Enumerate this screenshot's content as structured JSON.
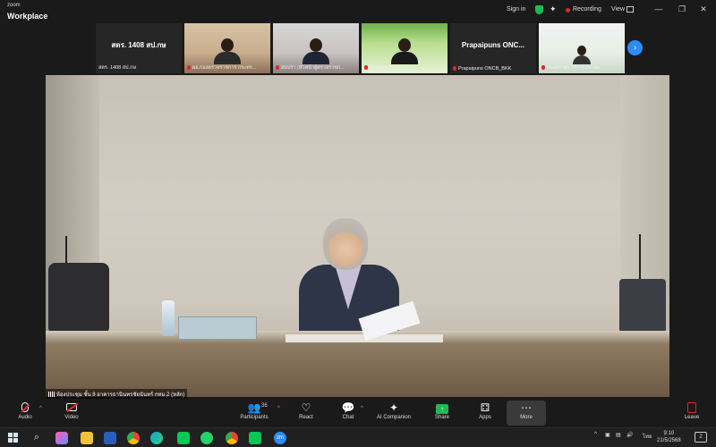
{
  "app": {
    "brand_small": "zoom",
    "brand_big": "Workplace"
  },
  "topbar": {
    "signin_label": "Sign in",
    "recording_label": "Recording",
    "view_label": "View"
  },
  "participants_strip": [
    {
      "display_name": "สตร. 1408 สป.กษ",
      "caption": "สตร. 1408 สป.กษ",
      "muted": false,
      "video": false
    },
    {
      "caption": "ผอ.กองตรวจราชการ กระทร...",
      "muted": true,
      "video": true
    },
    {
      "caption": "สมปรา (หัวหน้าผู้ตรวจราชก...",
      "muted": true,
      "video": true
    },
    {
      "caption": "สาวลักษณ์ ผล.กษ",
      "muted": true,
      "video": true
    },
    {
      "display_name": "Prapaipuns ONC...",
      "caption": "Prapaipuns ONCB_BKK",
      "muted": true,
      "video": false
    },
    {
      "caption": "กองตรวจราชการ สป.กษ.",
      "muted": true,
      "video": true
    }
  ],
  "main_video": {
    "label": "ห้องประชุม ชั้น 8 อาคารธานินทรชัยนันทร์ กทม.2 (หลัก)"
  },
  "toolbar": {
    "audio_label": "Audio",
    "video_label": "Video",
    "participants_label": "Participants",
    "participants_count": "36",
    "react_label": "React",
    "chat_label": "Chat",
    "ai_label": "AI Companion",
    "share_label": "Share",
    "apps_label": "Apps",
    "more_label": "More",
    "leave_label": "Leave"
  },
  "taskbar": {
    "clock_time": "9:10",
    "clock_date": "21/5/2568",
    "lang": "ไทย",
    "notifications": "2"
  },
  "colors": {
    "accent_blue": "#2d8cff",
    "recording_red": "#e02828",
    "shield_green": "#1fb954"
  }
}
